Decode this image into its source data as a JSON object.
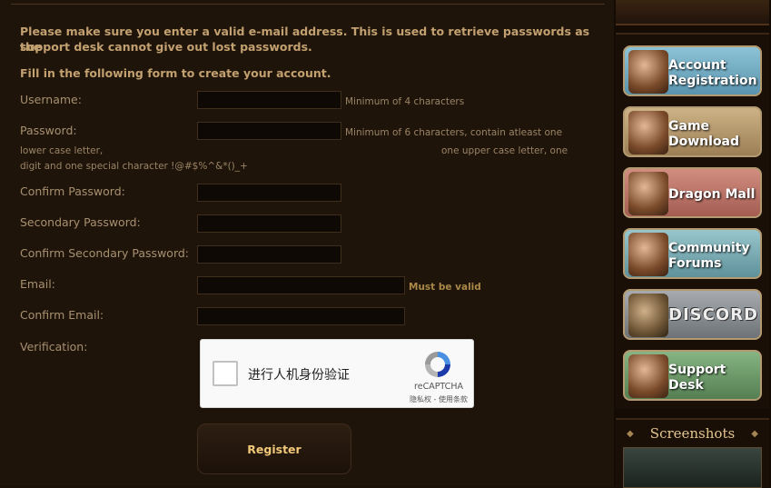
{
  "intro": {
    "line1": "Please make sure you enter a valid e-mail address. This is used to retrieve passwords as the",
    "line2": "support desk cannot give out lost passwords.",
    "line3": "Fill in the following form to create your account."
  },
  "form": {
    "username": {
      "label": "Username:",
      "hint": "Minimum of 4 characters",
      "value": ""
    },
    "password": {
      "label": "Password:",
      "hint": "Minimum of 6 characters, contain atleast one",
      "hint2_left": "lower case letter,",
      "hint2_right": "one upper case letter, one",
      "hint3": "digit and one special character !@#$%^&*()_+",
      "value": ""
    },
    "confirm_password": {
      "label": "Confirm Password:",
      "value": ""
    },
    "secondary_password": {
      "label": "Secondary Password:",
      "value": ""
    },
    "confirm_secondary_password": {
      "label": "Confirm Secondary Password:",
      "value": ""
    },
    "email": {
      "label": "Email:",
      "hint": "Must be valid",
      "value": ""
    },
    "confirm_email": {
      "label": "Confirm Email:",
      "value": ""
    },
    "verification": {
      "label": "Verification:"
    }
  },
  "captcha": {
    "text": "进行人机身份验证",
    "brand": "reCAPTCHA",
    "terms": "隐私权 - 使用条款",
    "checked": false
  },
  "register_label": "Register",
  "sidebar": {
    "buttons": [
      {
        "label1": "Account",
        "label2": "Registration",
        "bg": "#6ea7c0",
        "icon": "warrior-portrait-icon"
      },
      {
        "label1": "Game",
        "label2": "Download",
        "bg": "#b79b6f",
        "icon": "barbarian-portrait-icon"
      },
      {
        "label1": "Dragon Mall",
        "label2": "",
        "bg": "#bc7568",
        "icon": "archer-portrait-icon"
      },
      {
        "label1": "Community",
        "label2": "Forums",
        "bg": "#7fb0b8",
        "icon": "dwarf-portrait-icon"
      },
      {
        "label1": "DISCORD",
        "label2": "",
        "bg": "#8a8e92",
        "icon": "dragon-icon"
      },
      {
        "label1": "Support",
        "label2": "Desk",
        "bg": "#6b9a6a",
        "icon": "knight-portrait-icon"
      }
    ],
    "screenshots_title": "Screenshots"
  },
  "colors": {
    "accent": "#f0c878",
    "text": "#a79070",
    "intro": "#c2a070"
  }
}
